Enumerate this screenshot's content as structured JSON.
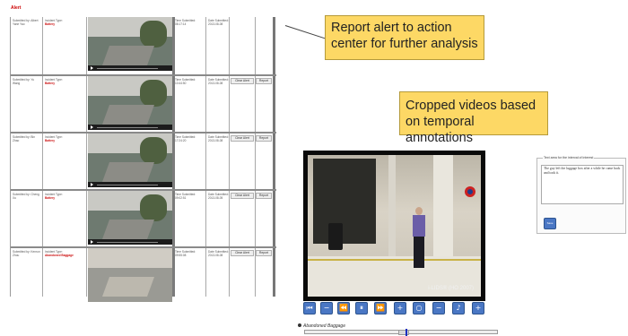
{
  "alert_panel": {
    "title": "Alert",
    "rows": [
      {
        "submitted_by": "Submitted by: Albert Yane Yao",
        "incident_label": "Incident Type:",
        "incident_type": "Battery",
        "time_label": "Time Submitted:",
        "time": "08:17:14",
        "date_label": "Date Submitted:",
        "date": "2013-08-08",
        "clear_label": "Clear Alert",
        "report_label": "Report"
      },
      {
        "submitted_by": "Submitted by: Yu Wang",
        "incident_label": "Incident Type:",
        "incident_type": "Battery",
        "time_label": "Time Submitted:",
        "time": "10:44:50",
        "date_label": "Date Submitted:",
        "date": "2013-08-08",
        "clear_label": "Clear Alert",
        "report_label": "Report"
      },
      {
        "submitted_by": "Submitted by: Bin Zhao",
        "incident_label": "Incident Type:",
        "incident_type": "Battery",
        "time_label": "Time Submitted:",
        "time": "17:24:20",
        "date_label": "Date Submitted:",
        "date": "2013-08-08",
        "clear_label": "Clear Alert",
        "report_label": "Report"
      },
      {
        "submitted_by": "Submitted by: Cheng Xu",
        "incident_label": "Incident Type:",
        "incident_type": "Battery",
        "time_label": "Time Submitted:",
        "time": "09:02:51",
        "date_label": "Date Submitted:",
        "date": "2013-08-05",
        "clear_label": "Clear Alert",
        "report_label": "Report"
      },
      {
        "submitted_by": "Submitted by: Kenrun Zhou",
        "incident_label": "Incident Type:",
        "incident_type": "Abandoned Baggage",
        "time_label": "Time Submitted:",
        "time": "09:55:08",
        "date_label": "Date Submitted:",
        "date": "2013-08-08",
        "clear_label": "Clear Alert",
        "report_label": "Report"
      }
    ]
  },
  "callouts": {
    "report": "Report alert to action center for further analysis",
    "cropped": "Cropped videos based on temporal annotations"
  },
  "video": {
    "watermark": "i-LIDS® (HO 2007)",
    "controls": [
      "⏮",
      "−",
      "⏪",
      "⏸",
      "⏩",
      "+",
      "○",
      "−",
      "♪",
      "+"
    ],
    "selected_annotation": "Abandoned Baggage"
  },
  "annotation": {
    "legend": "Text area for the interval of interest",
    "text": "The guy left the luggage box after a while he came back and took it.",
    "button_label": "Save"
  }
}
